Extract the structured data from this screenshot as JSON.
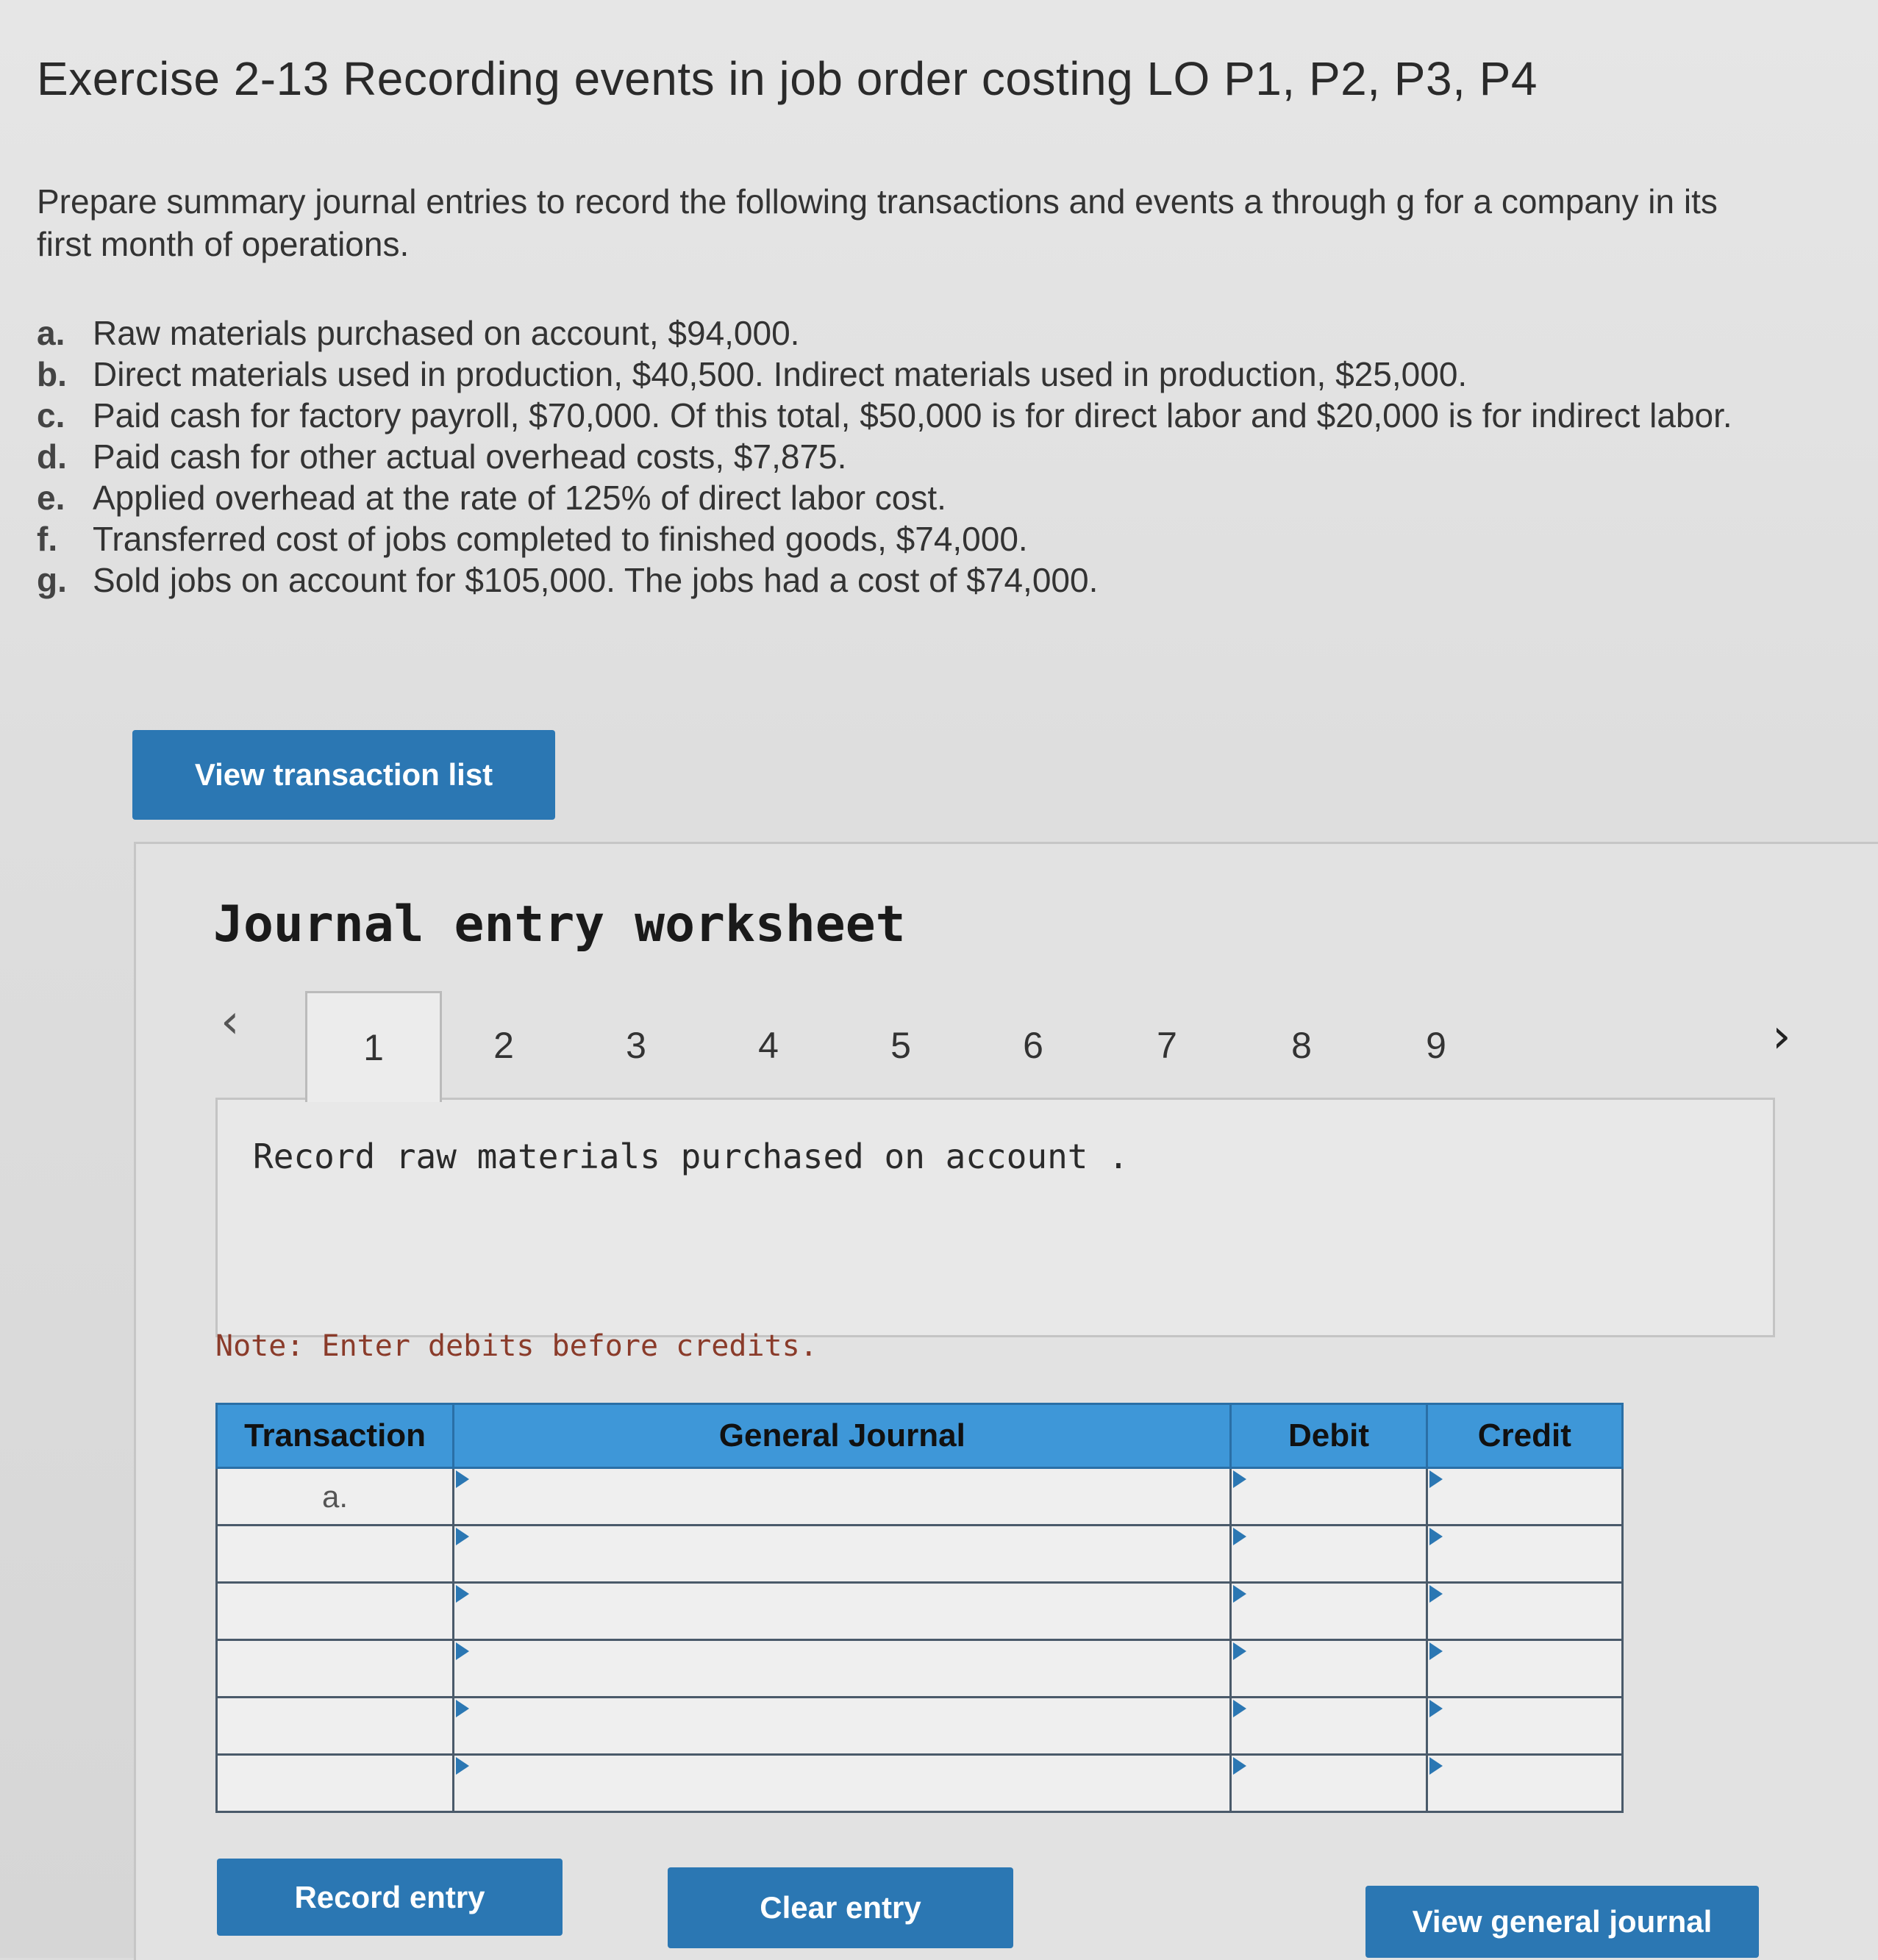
{
  "exercise": {
    "title": "Exercise 2-13 Recording events in job order costing LO P1, P2, P3, P4",
    "intro": "Prepare summary journal entries to record the following transactions and events a through g for a company in its first month of operations.",
    "events": [
      {
        "letter": "a.",
        "text": "Raw materials purchased on account, $94,000."
      },
      {
        "letter": "b.",
        "text": "Direct materials used in production, $40,500. Indirect materials used in production, $25,000."
      },
      {
        "letter": "c.",
        "text": "Paid cash for factory payroll, $70,000. Of this total, $50,000 is for direct labor and $20,000 is for indirect labor."
      },
      {
        "letter": "d.",
        "text": "Paid cash for other actual overhead costs, $7,875."
      },
      {
        "letter": "e.",
        "text": "Applied overhead at the rate of 125% of direct labor cost."
      },
      {
        "letter": "f.",
        "text": "Transferred cost of jobs completed to finished goods, $74,000."
      },
      {
        "letter": "g.",
        "text": "Sold jobs on account for $105,000. The jobs had a cost of $74,000."
      }
    ]
  },
  "buttons": {
    "view_transaction_list": "View transaction list",
    "record_entry": "Record entry",
    "clear_entry": "Clear entry",
    "view_general_journal": "View general journal"
  },
  "worksheet": {
    "title": "Journal entry worksheet",
    "prev_icon": "chevron-left-icon",
    "next_icon": "chevron-right-icon",
    "tabs": [
      "1",
      "2",
      "3",
      "4",
      "5",
      "6",
      "7",
      "8",
      "9"
    ],
    "active_tab": "1",
    "instruction": "Record raw materials purchased on account .",
    "note": "Note: Enter debits before credits.",
    "table": {
      "headers": [
        "Transaction",
        "General Journal",
        "Debit",
        "Credit"
      ],
      "rows": [
        {
          "transaction": "a.",
          "account": "",
          "debit": "",
          "credit": ""
        },
        {
          "transaction": "",
          "account": "",
          "debit": "",
          "credit": ""
        },
        {
          "transaction": "",
          "account": "",
          "debit": "",
          "credit": ""
        },
        {
          "transaction": "",
          "account": "",
          "debit": "",
          "credit": ""
        },
        {
          "transaction": "",
          "account": "",
          "debit": "",
          "credit": ""
        },
        {
          "transaction": "",
          "account": "",
          "debit": "",
          "credit": ""
        }
      ]
    }
  },
  "colors": {
    "button_blue": "#2b77b3",
    "header_blue": "#3e97d8",
    "note_text": "#8a3b2a"
  }
}
